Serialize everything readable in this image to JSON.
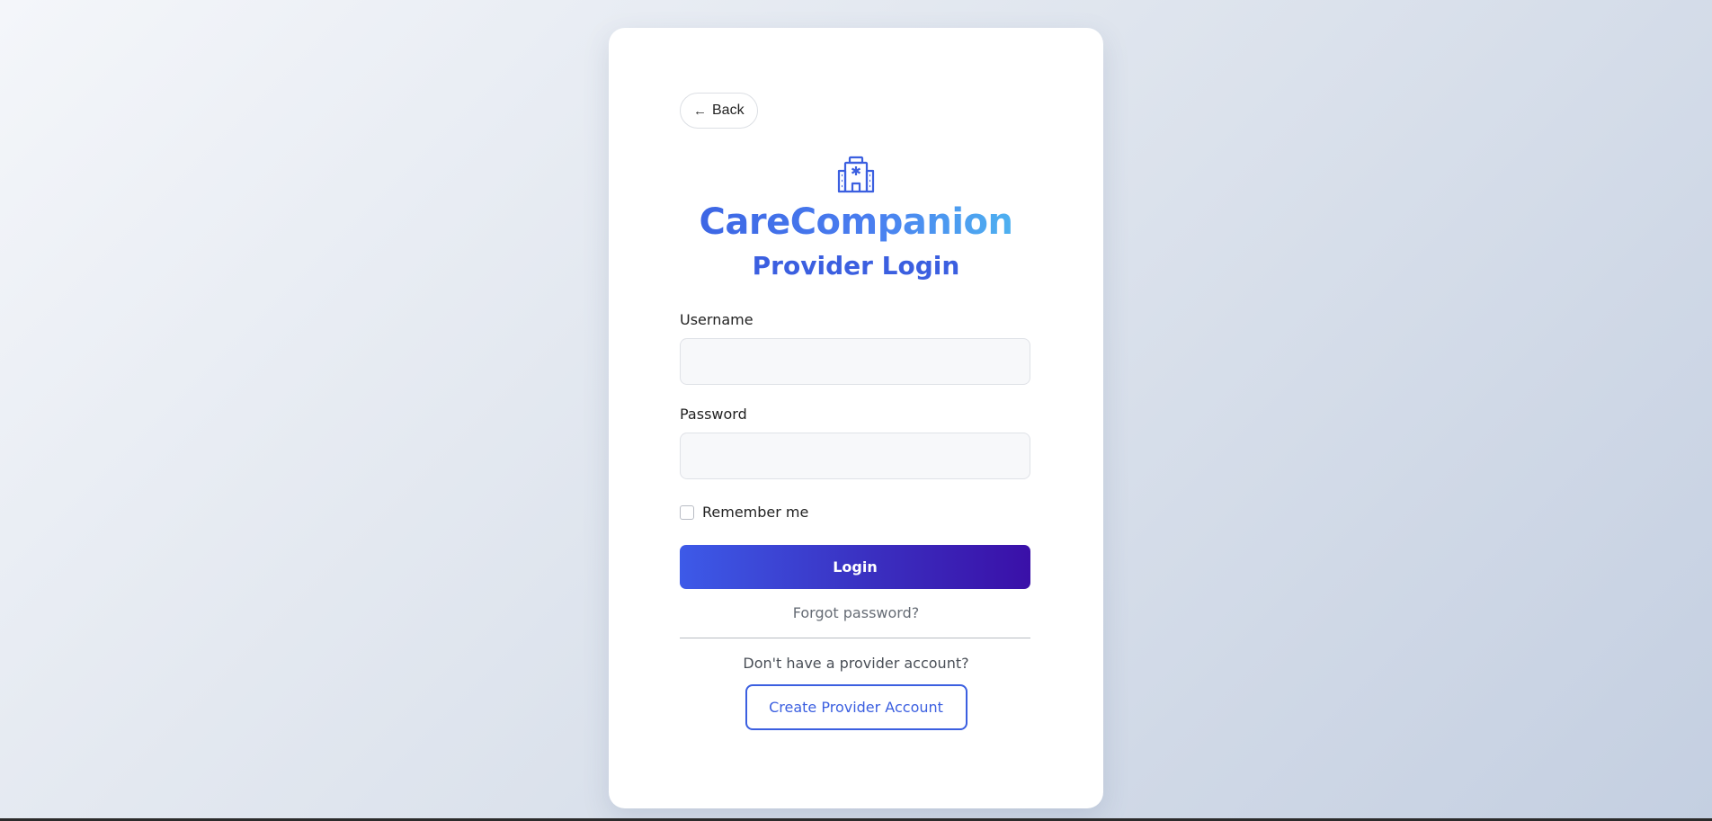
{
  "nav": {
    "back_arrow": "←",
    "back_label": "Back"
  },
  "brand": {
    "icon": "hospital-icon",
    "title": "CareCompanion",
    "subtitle": "Provider Login"
  },
  "form": {
    "username_label": "Username",
    "username_value": "",
    "password_label": "Password",
    "password_value": "",
    "remember_label": "Remember me",
    "remember_checked": false,
    "login_label": "Login",
    "forgot_label": "Forgot password?"
  },
  "signup": {
    "prompt": "Don't have a provider account?",
    "create_label": "Create Provider Account"
  },
  "colors": {
    "accent": "#3b5fe0",
    "gradient_start": "#3d5ae8",
    "gradient_end": "#3a10a8",
    "brand_light": "#4fb8f0"
  }
}
